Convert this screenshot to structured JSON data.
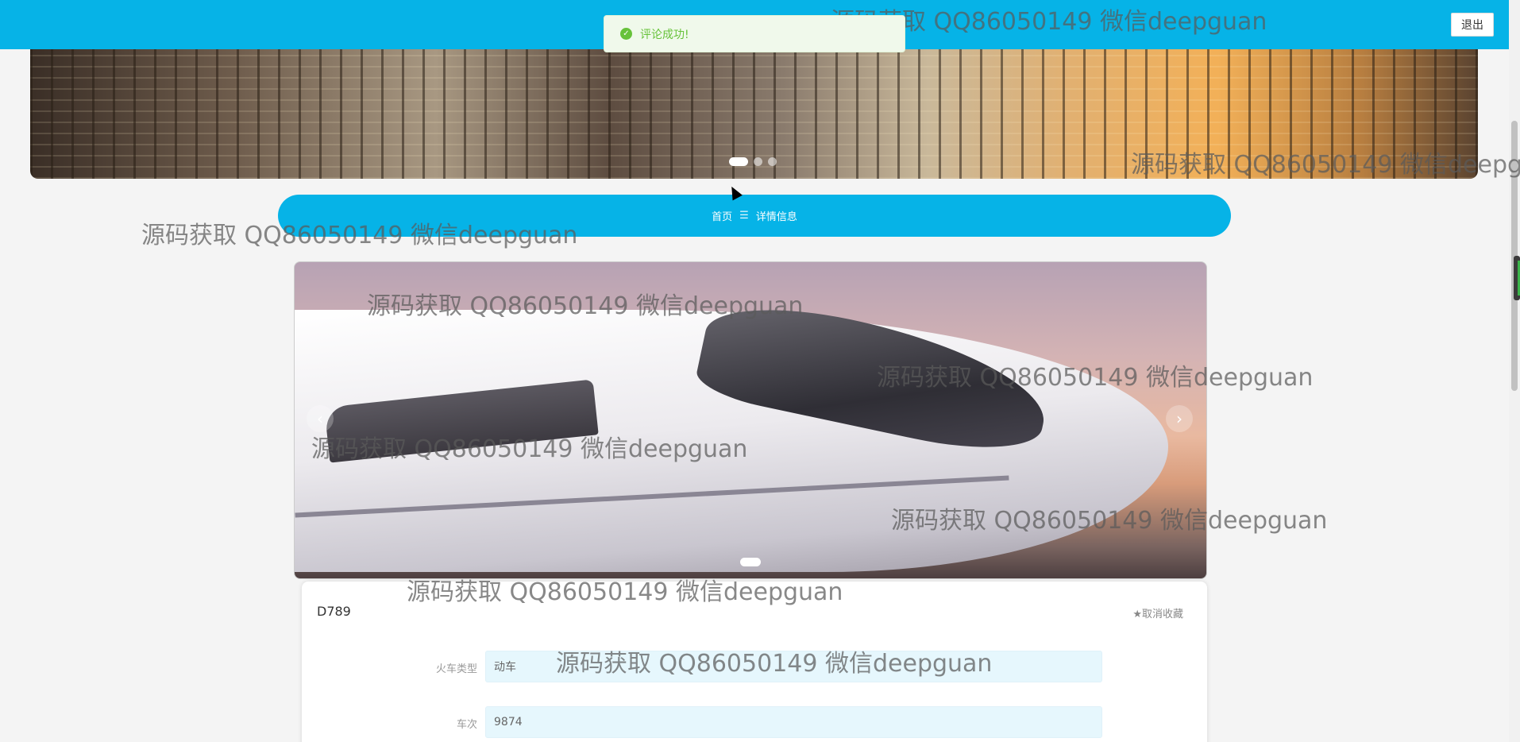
{
  "header": {
    "logout_label": "退出"
  },
  "toast": {
    "icon": "check-circle-icon",
    "message": "评论成功!"
  },
  "breadcrumb": {
    "home": "首页",
    "separator": "☰",
    "current": "详情信息"
  },
  "carousel": {
    "prev": "‹",
    "next": "›"
  },
  "detail": {
    "title": "D789",
    "favorite_label": "★取消收藏",
    "fields": [
      {
        "label": "火车类型",
        "value": "动车"
      },
      {
        "label": "车次",
        "value": "9874"
      }
    ]
  },
  "watermark": "源码获取 QQ86050149 微信deepguan",
  "watermark_short": "源码获取 QQ86050149 微信deepgu",
  "colors": {
    "primary": "#06b3e7",
    "success": "#67c23a",
    "field_bg": "#e6f7fd"
  }
}
